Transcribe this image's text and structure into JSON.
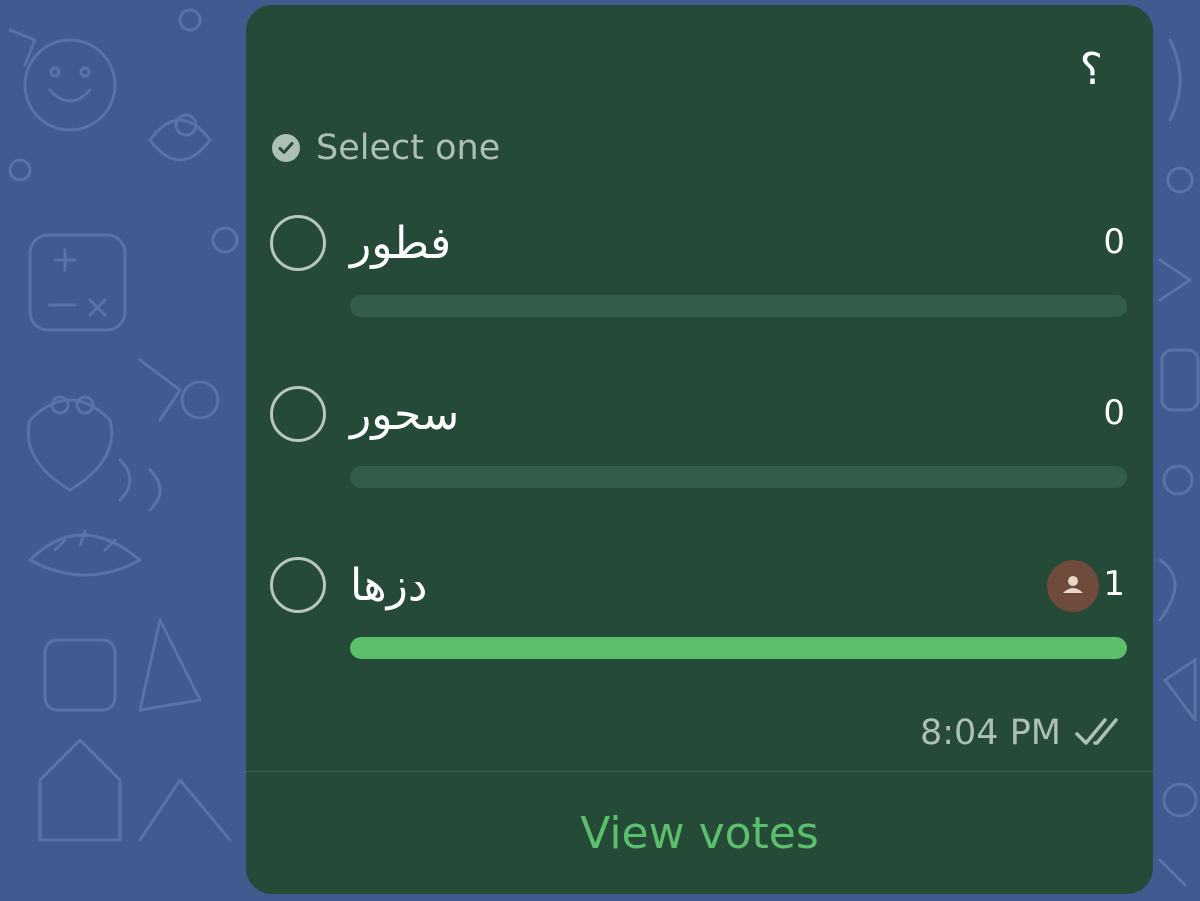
{
  "poll": {
    "question": "؟",
    "type_label": "Select one",
    "options": [
      {
        "label": "فطور",
        "count": "0",
        "percent": 0
      },
      {
        "label": "سحور",
        "count": "0",
        "percent": 0
      },
      {
        "label": "دزها",
        "count": "1",
        "percent": 100
      }
    ],
    "time": "8:04 PM",
    "status_icon": "double-check-icon",
    "view_votes_label": "View votes"
  },
  "colors": {
    "wallpaper": "#3f5b8f",
    "bubble": "#254a38",
    "accent": "#5bbf6c",
    "bar_track": "#345c4a",
    "muted_text": "#aebfb3",
    "avatar": "#6e4b3c"
  }
}
